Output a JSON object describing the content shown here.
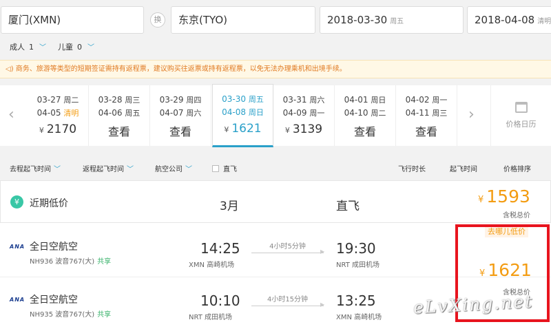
{
  "search": {
    "from": "厦门(XMN)",
    "swap": "换",
    "to": "东京(TYO)",
    "depart_date": "2018-03-30",
    "depart_week": "周五",
    "return_date": "2018-04-08",
    "return_week": "清明"
  },
  "passengers": {
    "adult_label": "成人",
    "adult_count": "1",
    "child_label": "儿童",
    "child_count": "0"
  },
  "notice": "商务、旅游等类型的短期签证需持有返程票，建议购买往返票或持有返程票，以免无法办理乘机和出境手续。",
  "date_strip": [
    {
      "go": "03-27",
      "go_wk": "周二",
      "back": "04-05",
      "back_wk": "清明",
      "price": "2170",
      "yen": "¥"
    },
    {
      "go": "03-28",
      "go_wk": "周三",
      "back": "04-06",
      "back_wk": "周五",
      "look": "查看"
    },
    {
      "go": "03-29",
      "go_wk": "周四",
      "back": "04-07",
      "back_wk": "周六",
      "look": "查看"
    },
    {
      "go": "03-30",
      "go_wk": "周五",
      "back": "04-08",
      "back_wk": "周日",
      "price": "1621",
      "yen": "¥"
    },
    {
      "go": "03-31",
      "go_wk": "周六",
      "back": "04-09",
      "back_wk": "周一",
      "price": "3139",
      "yen": "¥"
    },
    {
      "go": "04-01",
      "go_wk": "周日",
      "back": "04-10",
      "back_wk": "周二",
      "look": "查看"
    },
    {
      "go": "04-02",
      "go_wk": "周一",
      "back": "04-11",
      "back_wk": "周三",
      "look": "查看"
    }
  ],
  "calendar_label": "价格日历",
  "filters": {
    "depart_time": "去程起飞时间",
    "return_time": "返程起飞时间",
    "airline": "航空公司",
    "direct": "直飞",
    "duration_sort": "飞行时长",
    "takeoff_sort": "起飞时间",
    "price_sort": "价格排序"
  },
  "low_price": {
    "label": "近期低价",
    "yen_icon": "¥",
    "month": "3月",
    "direct": "直飞",
    "yen": "¥",
    "price": "1593",
    "tax": "含税总价"
  },
  "flights": [
    {
      "logo": "ANA",
      "airline": "全日空航空",
      "number": "NH936 波音767(大)",
      "share": "共享",
      "dep_time": "14:25",
      "dep_apt": "XMN 高崎机场",
      "duration": "4小时5分钟",
      "arr_time": "19:30",
      "arr_apt": "NRT 成田机场"
    },
    {
      "logo": "ANA",
      "airline": "全日空航空",
      "number": "NH935 波音767(大)",
      "share": "共享",
      "dep_time": "10:10",
      "dep_apt": "NRT 成田机场",
      "duration": "4小时15分钟",
      "arr_time": "13:25",
      "arr_apt": "XMN 高崎机场"
    }
  ],
  "offer": {
    "tag": "去哪儿低价",
    "yen": "¥",
    "price": "1621",
    "tax": "含税总价"
  },
  "watermark": "eLvXing.net",
  "colors": {
    "accent": "#2aa0c9",
    "price_orange": "#f39c12",
    "notice_text": "#e07a22",
    "highlight_red": "#e8141e",
    "green": "#39c7a6"
  }
}
